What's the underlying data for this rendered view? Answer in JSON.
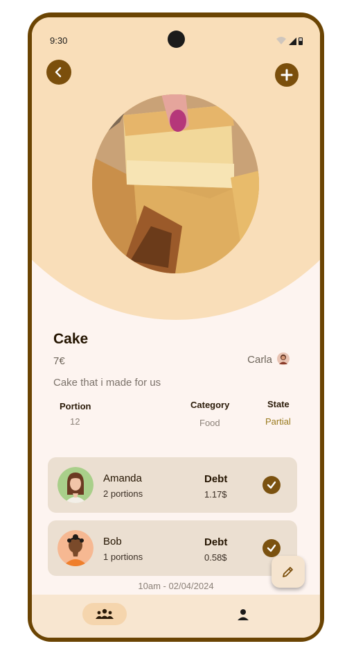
{
  "status": {
    "time": "9:30"
  },
  "item": {
    "title": "Cake",
    "price": "7€",
    "owner": "Carla",
    "description": "Cake that i made for us"
  },
  "details": {
    "portion_label": "Portion",
    "portion_value": "12",
    "category_label": "Category",
    "category_value": "Food",
    "state_label": "State",
    "state_value": "Partial"
  },
  "participants": [
    {
      "name": "Amanda",
      "portions": "2 portions",
      "debt_label": "Debt",
      "debt_value": "1.17$"
    },
    {
      "name": "Bob",
      "portions": "1 portions",
      "debt_label": "Debt",
      "debt_value": "0.58$"
    }
  ],
  "timestamp": "10am - 02/04/2024",
  "icons": {
    "back": "arrow-left-icon",
    "add": "plus-icon",
    "check": "check-icon",
    "edit": "pencil-icon",
    "group": "group-icon",
    "person": "person-icon"
  },
  "colors": {
    "primary": "#7b4f0c",
    "hero": "#f9deb9",
    "card": "#ebdfd1",
    "state_partial": "#9a7b1f"
  }
}
